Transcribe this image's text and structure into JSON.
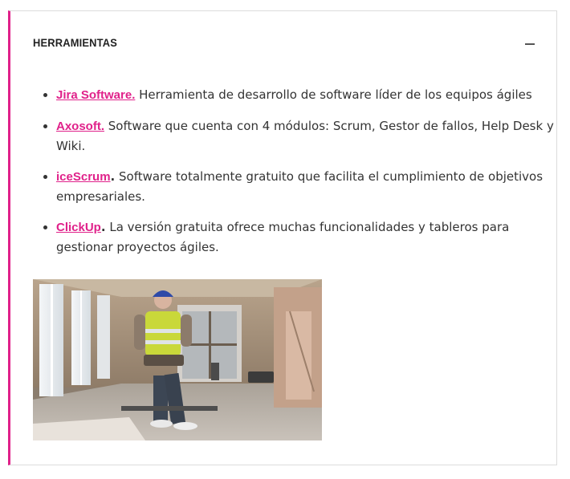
{
  "section": {
    "title": "HERRAMIENTAS",
    "accent_color": "#e0218a"
  },
  "toggle": {
    "icon": "minus-icon"
  },
  "tools": [
    {
      "name": "Jira Software.",
      "description": " Herramienta de desarrollo de software líder de los equipos ágiles"
    },
    {
      "name": "Axosoft.",
      "description": " Software que cuenta con 4 módulos: Scrum, Gestor de fallos, Help Desk y Wiki."
    },
    {
      "name": "iceScrum",
      "suffix": ".",
      "description": " Software totalmente gratuito que facilita el cumplimiento de objetivos empresariales."
    },
    {
      "name": "ClickUp",
      "suffix": ".",
      "description": " La versión gratuita ofrece muchas funcionalidades y tableros para gestionar proyectos ágiles."
    }
  ],
  "image": {
    "subject": "construction-worker-gif"
  }
}
